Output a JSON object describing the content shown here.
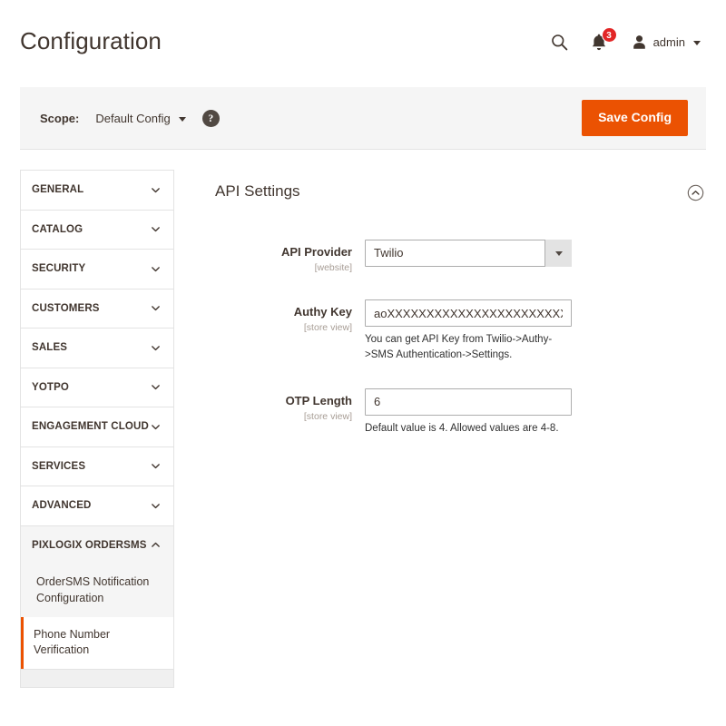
{
  "header": {
    "title": "Configuration",
    "search_icon": "search-icon",
    "notifications": {
      "icon": "bell-icon",
      "count": "3"
    },
    "user": {
      "icon": "user-icon",
      "name": "admin",
      "caret": "caret-down-icon"
    }
  },
  "scope_bar": {
    "label": "Scope:",
    "value": "Default Config",
    "help_icon": "question-mark-icon",
    "help_glyph": "?",
    "save_label": "Save Config"
  },
  "sidebar": {
    "sections": [
      {
        "label": "GENERAL",
        "expanded": false
      },
      {
        "label": "CATALOG",
        "expanded": false
      },
      {
        "label": "SECURITY",
        "expanded": false
      },
      {
        "label": "CUSTOMERS",
        "expanded": false
      },
      {
        "label": "SALES",
        "expanded": false
      },
      {
        "label": "YOTPO",
        "expanded": false
      },
      {
        "label": "ENGAGEMENT CLOUD",
        "expanded": false
      },
      {
        "label": "SERVICES",
        "expanded": false
      },
      {
        "label": "ADVANCED",
        "expanded": false
      },
      {
        "label": "PIXLOGIX ORDERSMS",
        "expanded": true
      }
    ],
    "children": [
      {
        "label": "OrderSMS Notification Configuration",
        "current": false
      },
      {
        "label": "Phone Number Verification",
        "current": true
      }
    ]
  },
  "main": {
    "section_title": "API Settings",
    "collapse_icon": "chevron-up-circle-icon",
    "fields": [
      {
        "label": "API Provider",
        "scope": "[website]",
        "type": "select",
        "value": "Twilio",
        "note": ""
      },
      {
        "label": "Authy Key",
        "scope": "[store view]",
        "type": "text",
        "value": "aoXXXXXXXXXXXXXXXXXXXXXXXXXXXXSf",
        "note": "You can get API Key from Twilio->Authy->SMS Authentication->Settings."
      },
      {
        "label": "OTP Length",
        "scope": "[store view]",
        "type": "text",
        "value": "6",
        "note": "Default value is 4. Allowed values are 4-8."
      }
    ]
  },
  "colors": {
    "accent_orange": "#eb5202",
    "badge_red": "#e22626",
    "text_dark": "#41362f",
    "muted": "#a79d95",
    "panel_gray": "#f5f5f5",
    "border": "#e3e3e3"
  }
}
